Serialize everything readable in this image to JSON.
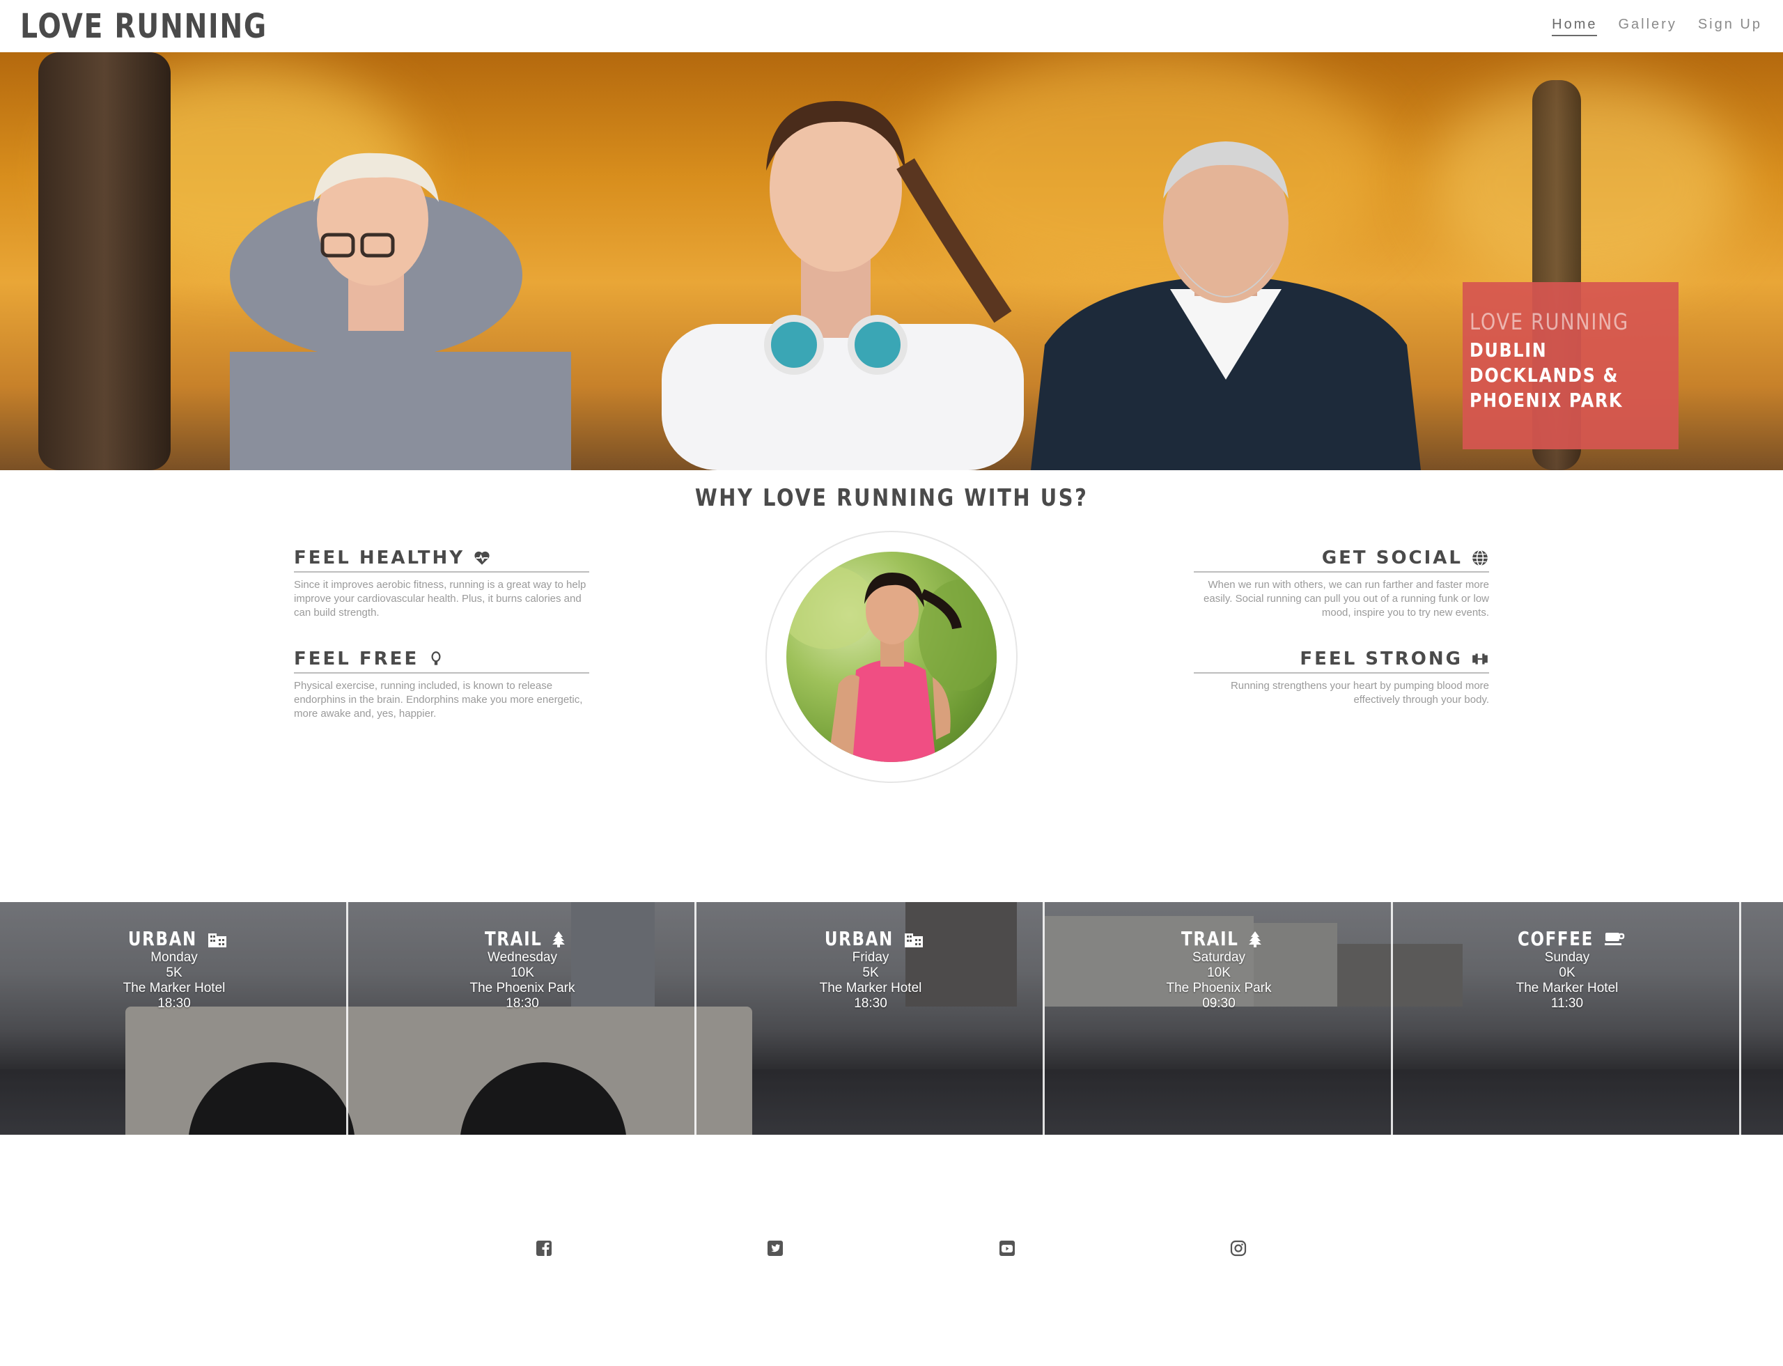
{
  "nav": {
    "brand": "LOVE RUNNING",
    "links": [
      {
        "label": "Home"
      },
      {
        "label": "Gallery"
      },
      {
        "label": "Sign Up"
      }
    ]
  },
  "hero": {
    "badge_title": "LOVE RUNNING",
    "badge_sub": "DUBLIN DOCKLANDS & PHOENIX PARK"
  },
  "why": {
    "title": "WHY LOVE RUNNING WITH US?",
    "features": [
      {
        "title": "FEEL HEALTHY",
        "icon": "heartbeat-icon",
        "text": "Since it improves aerobic fitness, running is a great way to help improve your cardiovascular health. Plus, it burns calories and can build strength."
      },
      {
        "title": "FEEL FREE",
        "icon": "lightbulb-icon",
        "text": "Physical exercise, running included, is known to release endorphins in the brain. Endorphins make you more energetic, more awake and, yes, happier."
      },
      {
        "title": "GET SOCIAL",
        "icon": "globe-icon",
        "text": "When we run with others, we can run farther and faster more easily. Social running can pull you out of a running funk or low mood, inspire you to try new events."
      },
      {
        "title": "FEEL STRONG",
        "icon": "dumbbell-icon",
        "text": "Running strengthens your heart by pumping blood more effectively through your body."
      }
    ]
  },
  "schedule": [
    {
      "type": "URBAN",
      "icon": "building-icon",
      "day": "Monday",
      "distance": "5K",
      "location": "The Marker Hotel",
      "time": "18:30"
    },
    {
      "type": "TRAIL",
      "icon": "tree-icon",
      "day": "Wednesday",
      "distance": "10K",
      "location": "The Phoenix Park",
      "time": "18:30"
    },
    {
      "type": "URBAN",
      "icon": "building-icon",
      "day": "Friday",
      "distance": "5K",
      "location": "The Marker Hotel",
      "time": "18:30"
    },
    {
      "type": "TRAIL",
      "icon": "tree-icon",
      "day": "Saturday",
      "distance": "10K",
      "location": "The Phoenix Park",
      "time": "09:30"
    },
    {
      "type": "COFFEE",
      "icon": "coffee-icon",
      "day": "Sunday",
      "distance": "0K",
      "location": "The Marker Hotel",
      "time": "11:30"
    }
  ],
  "footer": {
    "social": [
      "facebook-icon",
      "twitter-icon",
      "youtube-icon",
      "instagram-icon"
    ]
  },
  "colors": {
    "badge": "#d65650",
    "text": "#4a4a4a",
    "muted": "#9a9a9a"
  }
}
